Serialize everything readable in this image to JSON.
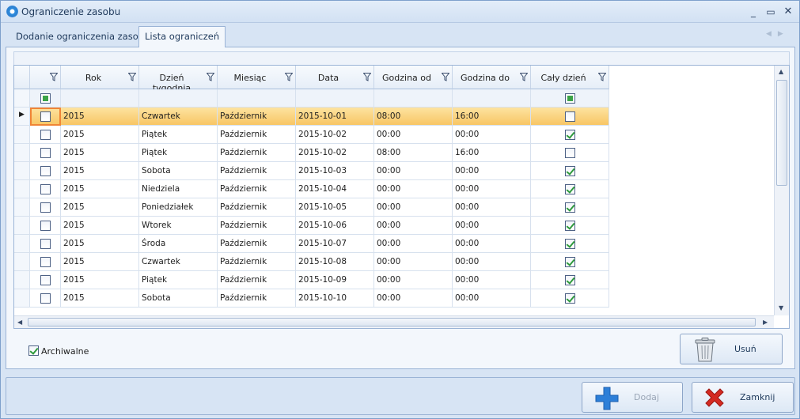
{
  "window": {
    "title": "Ograniczenie zasobu",
    "controls": [
      "minimize-icon",
      "restore-icon",
      "close-icon"
    ]
  },
  "tabs": [
    {
      "label": "Dodanie ograniczenia zasobu",
      "active": false
    },
    {
      "label": "Lista ograniczeń",
      "active": true
    }
  ],
  "grid": {
    "columns": [
      "",
      "Rok",
      "Dzień tygodnia",
      "Miesiąc",
      "Data",
      "Godzina od",
      "Godzina do",
      "Cały dzień"
    ],
    "rows": [
      {
        "selected": true,
        "checked": false,
        "rok": "2015",
        "dzien": "Czwartek",
        "miesiac": "Październik",
        "data": "2015-10-01",
        "od": "08:00",
        "do": "16:00",
        "caly": false
      },
      {
        "selected": false,
        "checked": false,
        "rok": "2015",
        "dzien": "Piątek",
        "miesiac": "Październik",
        "data": "2015-10-02",
        "od": "00:00",
        "do": "00:00",
        "caly": true
      },
      {
        "selected": false,
        "checked": false,
        "rok": "2015",
        "dzien": "Piątek",
        "miesiac": "Październik",
        "data": "2015-10-02",
        "od": "08:00",
        "do": "16:00",
        "caly": false
      },
      {
        "selected": false,
        "checked": false,
        "rok": "2015",
        "dzien": "Sobota",
        "miesiac": "Październik",
        "data": "2015-10-03",
        "od": "00:00",
        "do": "00:00",
        "caly": true
      },
      {
        "selected": false,
        "checked": false,
        "rok": "2015",
        "dzien": "Niedziela",
        "miesiac": "Październik",
        "data": "2015-10-04",
        "od": "00:00",
        "do": "00:00",
        "caly": true
      },
      {
        "selected": false,
        "checked": false,
        "rok": "2015",
        "dzien": "Poniedziałek",
        "miesiac": "Październik",
        "data": "2015-10-05",
        "od": "00:00",
        "do": "00:00",
        "caly": true
      },
      {
        "selected": false,
        "checked": false,
        "rok": "2015",
        "dzien": "Wtorek",
        "miesiac": "Październik",
        "data": "2015-10-06",
        "od": "00:00",
        "do": "00:00",
        "caly": true
      },
      {
        "selected": false,
        "checked": false,
        "rok": "2015",
        "dzien": "Środa",
        "miesiac": "Październik",
        "data": "2015-10-07",
        "od": "00:00",
        "do": "00:00",
        "caly": true
      },
      {
        "selected": false,
        "checked": false,
        "rok": "2015",
        "dzien": "Czwartek",
        "miesiac": "Październik",
        "data": "2015-10-08",
        "od": "00:00",
        "do": "00:00",
        "caly": true
      },
      {
        "selected": false,
        "checked": false,
        "rok": "2015",
        "dzien": "Piątek",
        "miesiac": "Październik",
        "data": "2015-10-09",
        "od": "00:00",
        "do": "00:00",
        "caly": true
      },
      {
        "selected": false,
        "checked": false,
        "rok": "2015",
        "dzien": "Sobota",
        "miesiac": "Październik",
        "data": "2015-10-10",
        "od": "00:00",
        "do": "00:00",
        "caly": true
      }
    ]
  },
  "archive": {
    "label": "Archiwalne",
    "checked": true
  },
  "buttons": {
    "delete": "Usuń",
    "add": "Dodaj",
    "close": "Zamknij"
  },
  "colors": {
    "selected_row": "#f8c665",
    "focus_outline": "#f08436",
    "check_green": "#2e9a3c",
    "add_icon": "#2d7fd8",
    "close_icon": "#d42a22"
  }
}
